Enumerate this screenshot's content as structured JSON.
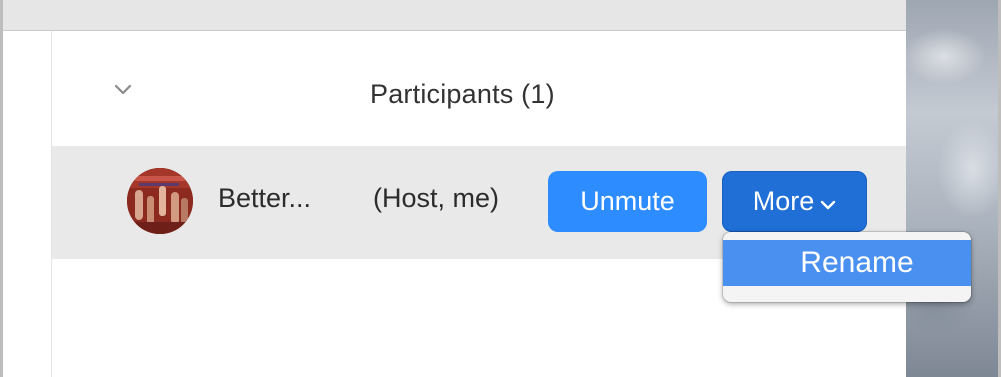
{
  "panel": {
    "title": "Participants (1)"
  },
  "participant": {
    "name": "Better...",
    "role": "(Host, me)",
    "unmute_label": "Unmute",
    "more_label": "More"
  },
  "menu": {
    "items": [
      {
        "label": "Rename"
      }
    ]
  },
  "colors": {
    "accent": "#2d8cff",
    "accent_pressed": "#1f6fd6",
    "menu_highlight": "#4a90f0",
    "row_background": "#e9e9e9"
  },
  "icons": {
    "collapse": "chevron-down-icon",
    "more_dropdown": "chevron-down-icon"
  }
}
